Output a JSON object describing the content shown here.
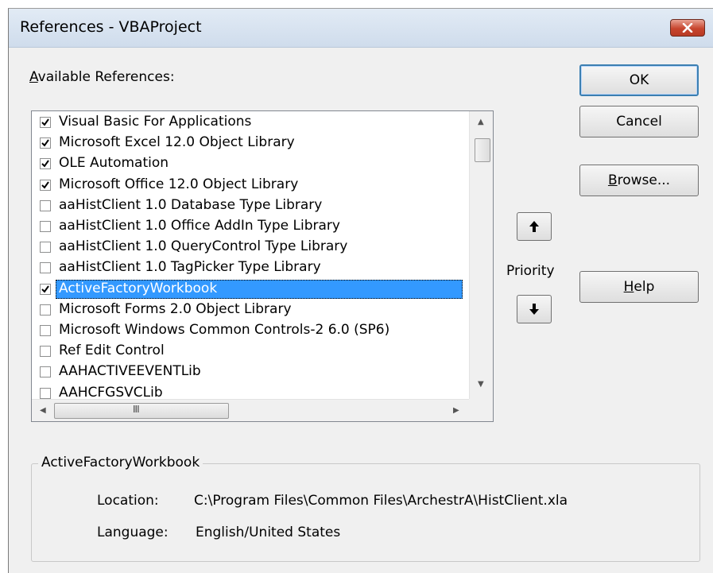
{
  "window": {
    "title": "References - VBAProject",
    "close_icon": "close-x-icon"
  },
  "available_label": {
    "mnemonic": "A",
    "rest": "vailable References:"
  },
  "buttons": {
    "ok": "OK",
    "cancel": "Cancel",
    "browse_mnemonic": "B",
    "browse_rest": "rowse...",
    "help_mnemonic": "H",
    "help_rest": "elp"
  },
  "priority": {
    "label": "Priority",
    "up_icon": "arrow-up-icon",
    "down_icon": "arrow-down-icon"
  },
  "references": [
    {
      "label": "Visual Basic For Applications",
      "checked": true,
      "selected": false
    },
    {
      "label": "Microsoft Excel 12.0 Object Library",
      "checked": true,
      "selected": false
    },
    {
      "label": "OLE Automation",
      "checked": true,
      "selected": false
    },
    {
      "label": "Microsoft Office 12.0 Object Library",
      "checked": true,
      "selected": false
    },
    {
      "label": "aaHistClient 1.0 Database Type Library",
      "checked": false,
      "selected": false
    },
    {
      "label": "aaHistClient 1.0 Office AddIn Type Library",
      "checked": false,
      "selected": false
    },
    {
      "label": "aaHistClient 1.0 QueryControl Type Library",
      "checked": false,
      "selected": false
    },
    {
      "label": "aaHistClient 1.0 TagPicker Type Library",
      "checked": false,
      "selected": false
    },
    {
      "label": "ActiveFactoryWorkbook",
      "checked": true,
      "selected": true
    },
    {
      "label": "Microsoft Forms 2.0 Object Library",
      "checked": false,
      "selected": false
    },
    {
      "label": "Microsoft Windows Common Controls-2 6.0 (SP6)",
      "checked": false,
      "selected": false
    },
    {
      "label": "Ref Edit Control",
      "checked": false,
      "selected": false
    },
    {
      "label": "AAHACTIVEEVENTLib",
      "checked": false,
      "selected": false
    },
    {
      "label": "AAHCFGSVCLib",
      "checked": false,
      "selected": false
    }
  ],
  "hscroll_grip": "III",
  "details": {
    "group_title": "ActiveFactoryWorkbook",
    "location_label": "Location:",
    "location_value": "C:\\Program Files\\Common Files\\ArchestrA\\HistClient.xla",
    "language_label": "Language:",
    "language_value": "English/United States"
  },
  "colors": {
    "selection": "#3399ff",
    "dialog_bg": "#f0f0f0",
    "close_button": "#c7452e"
  }
}
